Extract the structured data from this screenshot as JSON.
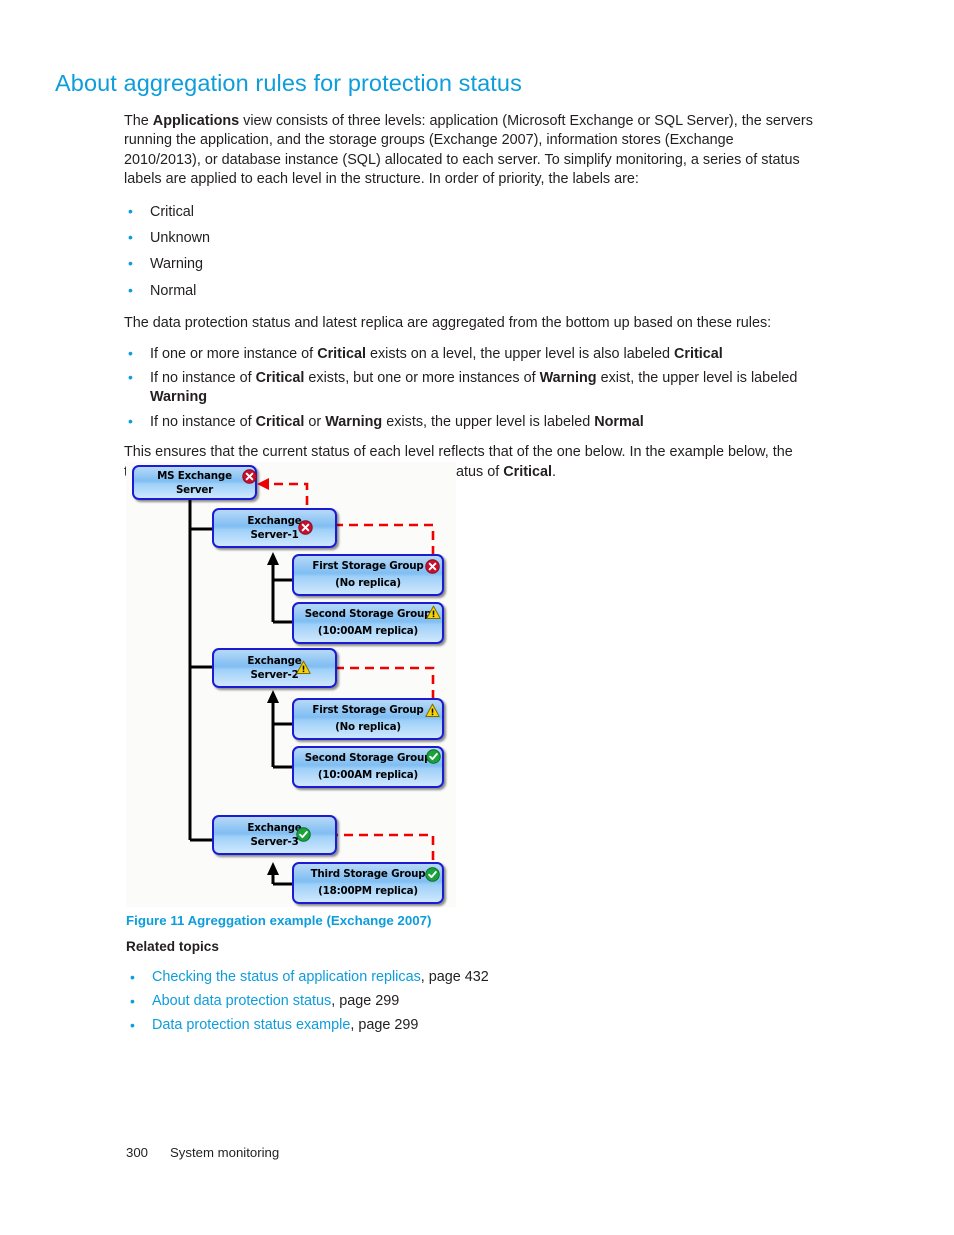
{
  "heading": "About aggregation rules for protection status",
  "intro": {
    "before_bold": "The ",
    "bold": "Applications",
    "after_bold": " view consists of three levels: application (Microsoft Exchange or SQL Server), the servers running the application, and the storage groups (Exchange 2007), information stores (Exchange 2010/2013), or database instance (SQL) allocated to each server. To simplify monitoring, a series of status labels are applied to each level in the structure. In order of priority, the labels are:"
  },
  "status_labels": [
    "Critical",
    "Unknown",
    "Warning",
    "Normal"
  ],
  "rules_intro": "The data protection status and latest replica are aggregated from the bottom up based on these rules:",
  "rules": [
    {
      "p1": "If one or more instance of ",
      "b1": "Critical",
      "p2": " exists on a level, the upper level is also labeled ",
      "b2": "Critical",
      "p3": ""
    },
    {
      "p1": "If no instance of ",
      "b1": "Critical",
      "p2": " exists, but one or more instances of ",
      "b2": "Warning",
      "p3": " exist, the upper level is labeled ",
      "b3": "Warning"
    },
    {
      "p1": "If no instance of ",
      "b1": "Critical",
      "p2": " or ",
      "b2": "Warning",
      "p3": " exists, the upper level is labeled ",
      "b3": "Normal"
    }
  ],
  "closing": {
    "text_before": "This ensures that the current status of each level reflects that of the one below. In the example below, the top (application) level is tagged with an aggregate status of ",
    "bold": "Critical",
    "text_after": "."
  },
  "figure": {
    "caption": "Figure 11 Agreggation example (Exchange 2007)",
    "nodes": [
      {
        "id": "app",
        "line1": "MS Exchange",
        "line2": "Server",
        "status": "critical"
      },
      {
        "id": "srv1",
        "line1": "Exchange",
        "line2": "Server-1",
        "status": "critical"
      },
      {
        "id": "s1g1",
        "line1": "First Storage Group",
        "line2": "(No replica)",
        "status": "critical"
      },
      {
        "id": "s1g2",
        "line1": "Second Storage Group",
        "line2": "(10:00AM replica)",
        "status": "warning"
      },
      {
        "id": "srv2",
        "line1": "Exchange",
        "line2": "Server-2",
        "status": "warning"
      },
      {
        "id": "s2g1",
        "line1": "First Storage Group",
        "line2": "(No replica)",
        "status": "warning"
      },
      {
        "id": "s2g2",
        "line1": "Second Storage Group",
        "line2": "(10:00AM replica)",
        "status": "normal"
      },
      {
        "id": "srv3",
        "line1": "Exchange",
        "line2": "Server-3",
        "status": "normal"
      },
      {
        "id": "s3g1",
        "line1": "Third Storage Group",
        "line2": "(18:00PM replica)",
        "status": "normal"
      }
    ],
    "status_colors": {
      "critical": "#d00f1e",
      "warning": "#f5d20c",
      "normal": "#1aa33c",
      "aggregation_flow": "#f00000",
      "hierarchy_line": "#000000"
    }
  },
  "related": {
    "title": "Related topics",
    "items": [
      {
        "link": "Checking the status of application replicas",
        "page": ", page 432"
      },
      {
        "link": "About data protection status",
        "page": ", page 299"
      },
      {
        "link": "Data protection status example",
        "page": ", page 299"
      }
    ]
  },
  "footer": {
    "page_number": "300",
    "section": "System monitoring"
  }
}
